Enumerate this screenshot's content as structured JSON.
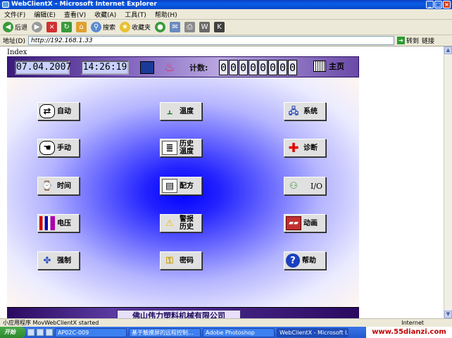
{
  "window": {
    "title": "WebClientX - Microsoft Internet Explorer"
  },
  "menu": [
    "文件(F)",
    "编辑(E)",
    "查看(V)",
    "收藏(A)",
    "工具(T)",
    "帮助(H)"
  ],
  "toolbar": {
    "back": "后退",
    "search": "搜索",
    "favorites": "收藏夹"
  },
  "address": {
    "label": "地址(D)",
    "url": "http://192.168.1.33",
    "go": "转到",
    "links": "链接"
  },
  "page": {
    "index_label": "Index",
    "date": "07.04.2007",
    "time": "14:26:19",
    "counter_label": "计数:",
    "counter_digits": [
      "0",
      "0",
      "0",
      "0",
      "0",
      "0",
      "0",
      "0"
    ],
    "home": "主页",
    "buttons": {
      "auto": "自动",
      "manual": "手动",
      "time": "时间",
      "voltage": "电压",
      "force": "强制",
      "temp": "温度",
      "history_temp": "历史\n温度",
      "recipe": "配方",
      "alarm_history": "警报\n历史",
      "password": "密码",
      "system": "系统",
      "diagnose": "诊断",
      "io": "I/O",
      "animation": "动画",
      "help": "帮助"
    },
    "company": "佛山伟力塑料机械有限公司"
  },
  "status": {
    "text": "小应用程序 MovWebClientX started",
    "zone": "Internet"
  },
  "taskbar": {
    "start": "开始",
    "tasks": [
      "AP02C-009",
      "基于触摸屏的远程控制...",
      "Adobe Photoshop",
      "WebClientX - Microsoft I..."
    ],
    "watermark": "www.55dianzi.com"
  }
}
